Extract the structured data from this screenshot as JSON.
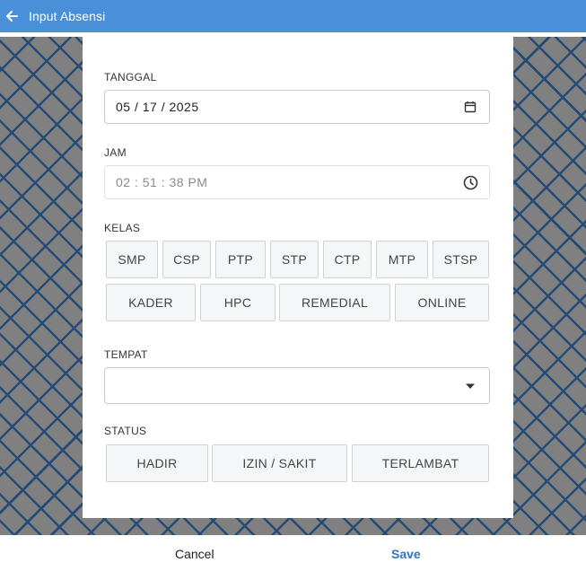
{
  "appbar": {
    "title": "Input Absensi",
    "back_icon": "arrow-left-icon"
  },
  "form": {
    "tanggal": {
      "label": "TANGGAL",
      "value": "05 / 17 / 2025",
      "icon": "calendar-icon"
    },
    "jam": {
      "label": "JAM",
      "value": "02 : 51 : 38  PM",
      "icon": "clock-icon"
    },
    "kelas": {
      "label": "KELAS",
      "options_row1": [
        "SMP",
        "CSP",
        "PTP",
        "STP",
        "CTP",
        "MTP",
        "STSP"
      ],
      "options_row2": [
        "KADER",
        "HPC",
        "REMEDIAL",
        "ONLINE"
      ]
    },
    "tempat": {
      "label": "TEMPAT",
      "value": "",
      "icon": "caret-down-icon"
    },
    "status": {
      "label": "STATUS",
      "options": [
        "HADIR",
        "IZIN / SAKIT",
        "TERLAMBAT"
      ]
    }
  },
  "footer": {
    "cancel_label": "Cancel",
    "save_label": "Save"
  },
  "colors": {
    "appbar": "#4a90d9",
    "save": "#2f74c0",
    "pattern": "#244a76",
    "pattern_bg": "#808080"
  }
}
